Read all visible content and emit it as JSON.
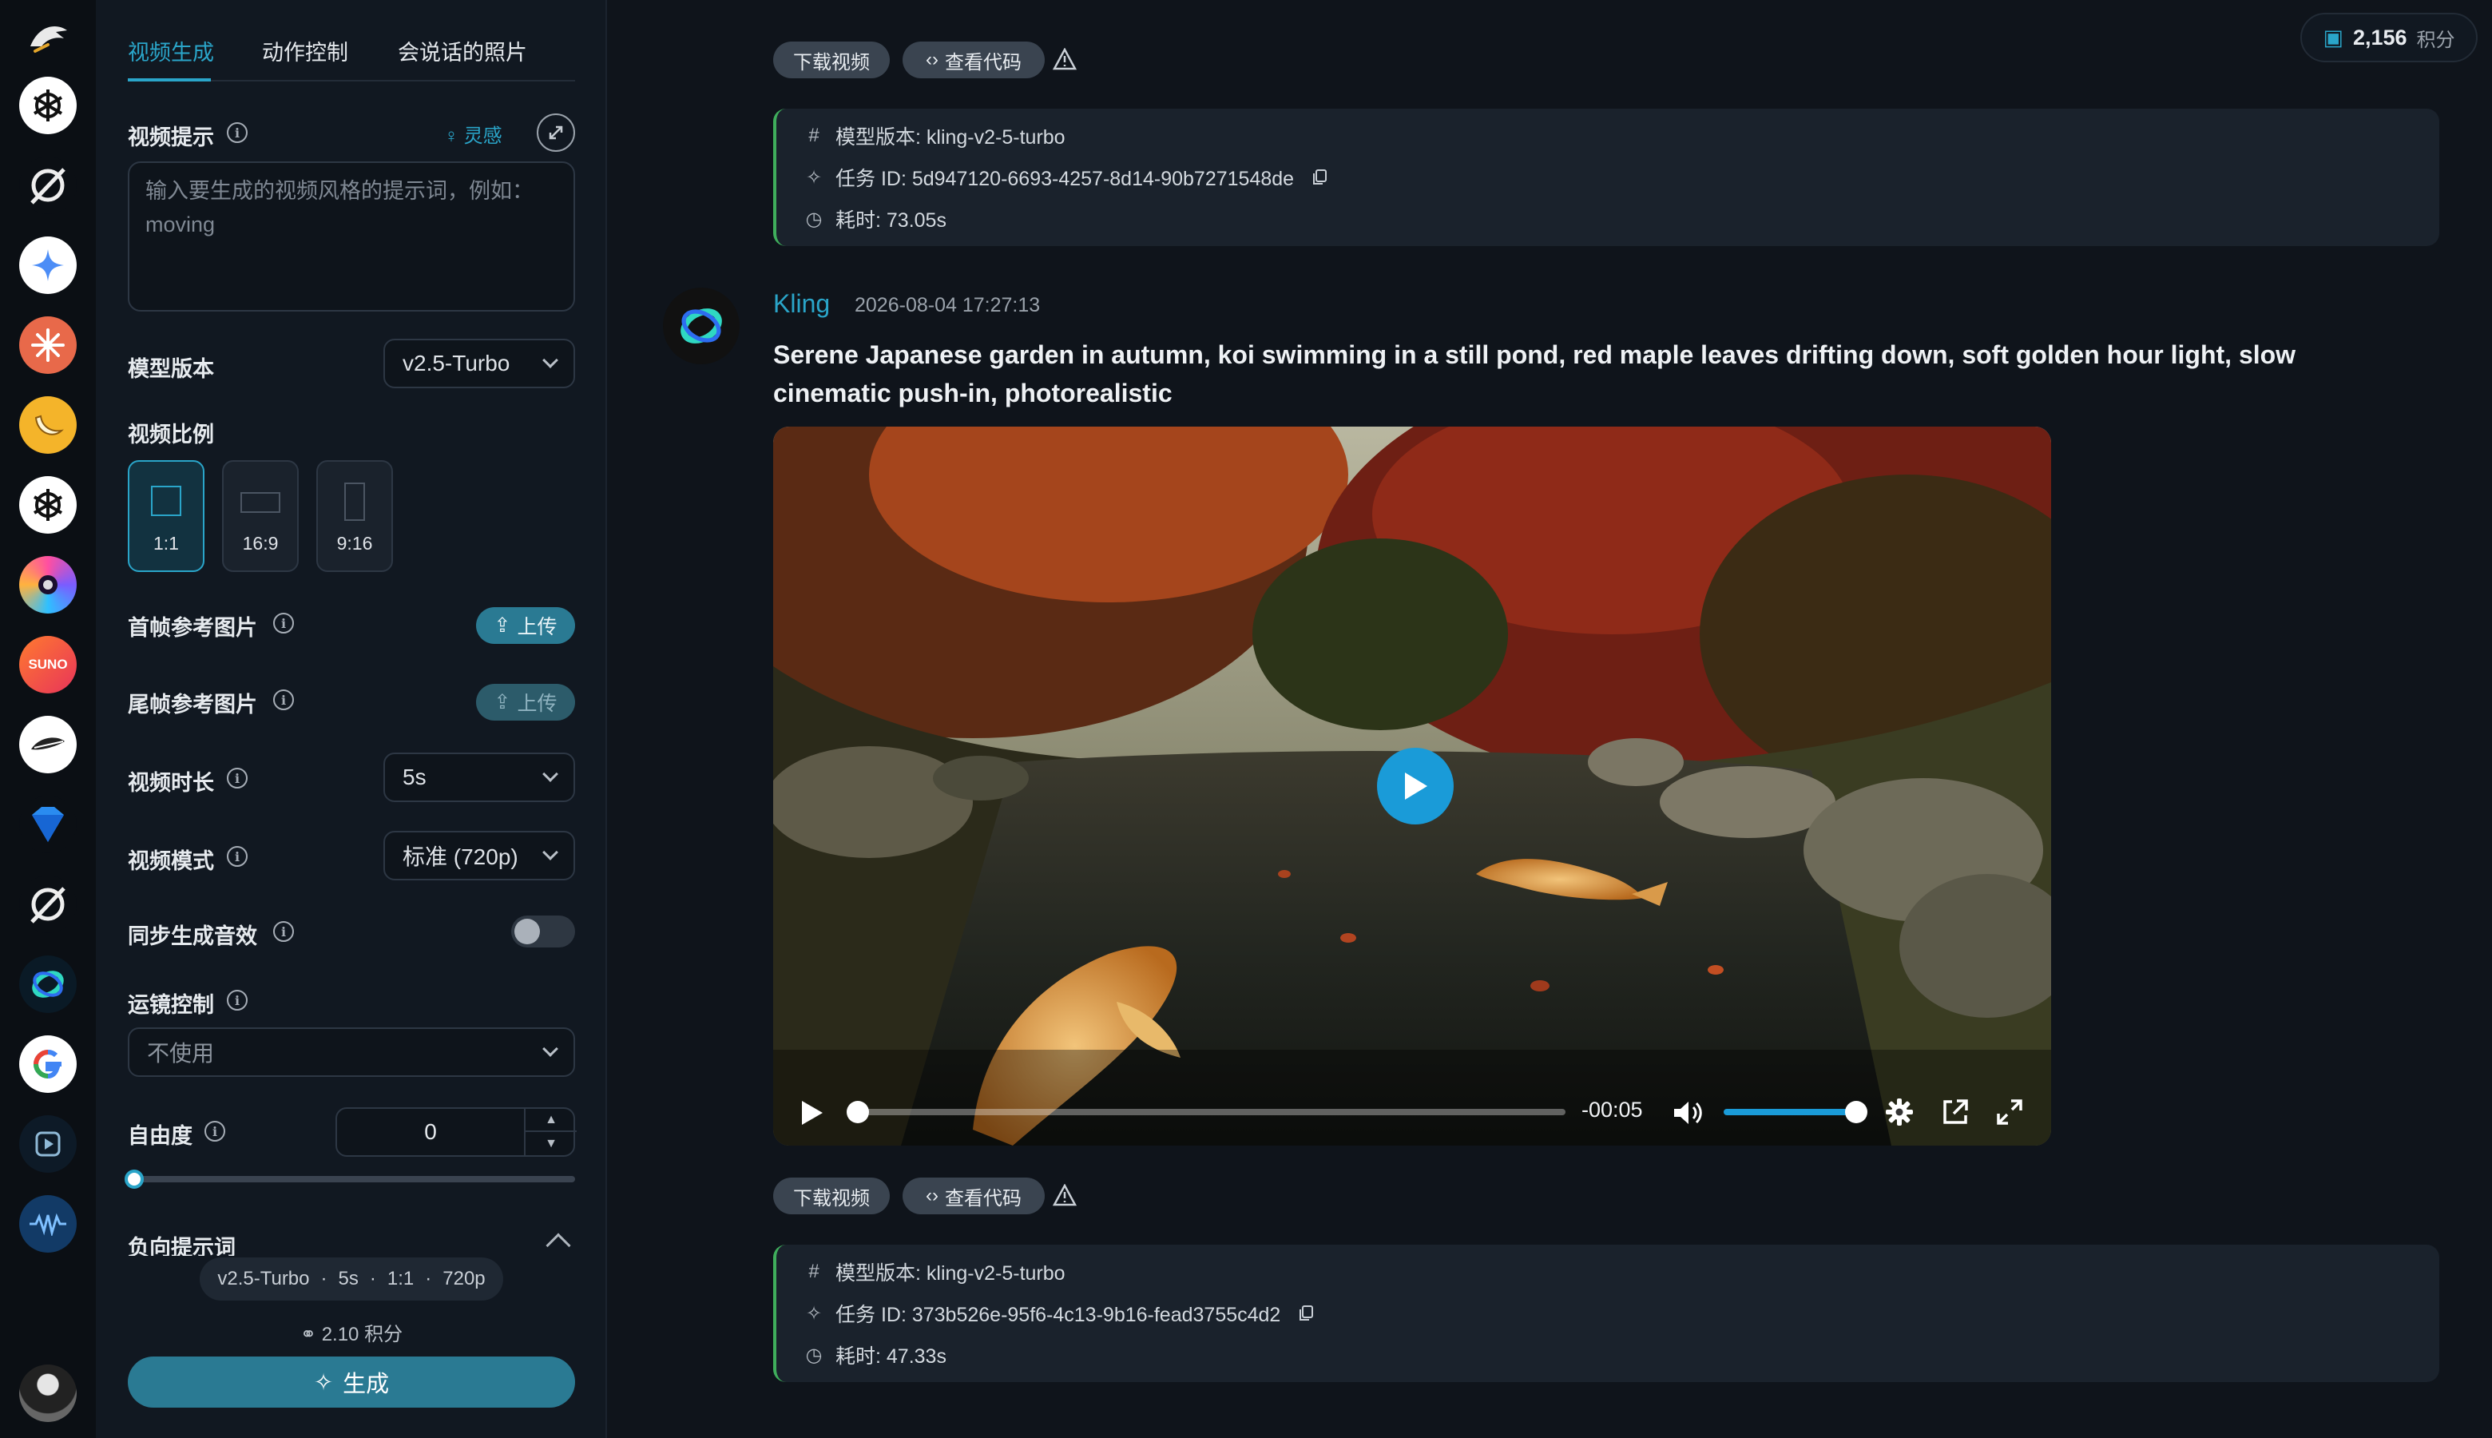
{
  "rail": {
    "icons": [
      "logo-icon",
      "openai-icon",
      "grok-icon",
      "gemini-icon",
      "claude-icon",
      "banana-icon",
      "openai-icon",
      "siri-icon",
      "suno-icon",
      "feather-icon",
      "gem-icon",
      "grok-icon",
      "kling-icon",
      "google-icon",
      "video-icon",
      "wave-icon",
      "user-avatar"
    ],
    "suno_label": "SUNO"
  },
  "panel": {
    "tabs": [
      "视频生成",
      "动作控制",
      "会说话的照片"
    ],
    "active_tab": 0,
    "prompt": {
      "label": "视频提示",
      "inspire": "灵感",
      "placeholder": "输入要生成的视频风格的提示词，例如：moving"
    },
    "model": {
      "label": "模型版本",
      "value": "v2.5-Turbo"
    },
    "ratio": {
      "label": "视频比例",
      "options": [
        "1:1",
        "16:9",
        "9:16"
      ],
      "selected": "1:1"
    },
    "first_frame": {
      "label": "首帧参考图片",
      "button": "上传"
    },
    "last_frame": {
      "label": "尾帧参考图片",
      "button": "上传"
    },
    "duration": {
      "label": "视频时长",
      "value": "5s"
    },
    "mode": {
      "label": "视频模式",
      "value": "标准 (720p)"
    },
    "sound": {
      "label": "同步生成音效",
      "enabled": false
    },
    "camera": {
      "label": "运镜控制",
      "value": "不使用"
    },
    "freedom": {
      "label": "自由度",
      "value": "0",
      "level": 0
    },
    "negative": {
      "label": "负向提示词"
    },
    "summary": [
      "v2.5-Turbo",
      "5s",
      "1:1",
      "720p"
    ],
    "summary_sep": "·",
    "cost": "2.10 积分",
    "generate": "生成"
  },
  "main": {
    "credits": {
      "value": "2,156",
      "unit": "积分"
    },
    "actions": {
      "download": "下载视频",
      "code": "查看代码"
    },
    "meta_top": {
      "model": "模型版本: kling-v2-5-turbo",
      "task": "任务 ID: 5d947120-6693-4257-8d14-90b7271548de",
      "time": "耗时: 73.05s"
    },
    "message": {
      "model": "Kling",
      "time": "2026-08-04 17:27:13",
      "text": "Serene Japanese garden in autumn, koi swimming in a still pond, red maple leaves drifting down, soft golden hour light, slow cinematic push-in, photorealistic"
    },
    "video": {
      "time": "-00:05",
      "progress": 0,
      "volume": 1
    },
    "meta_bottom": {
      "model": "模型版本: kling-v2-5-turbo",
      "task": "任务 ID: 373b526e-95f6-4c13-9b16-fead3755c4d2",
      "time": "耗时: 47.33s"
    }
  },
  "colors": {
    "accent": "#2aa5c9",
    "button": "#2a7a93",
    "success": "#3fae5c",
    "video_accent": "#1a9bd8"
  }
}
